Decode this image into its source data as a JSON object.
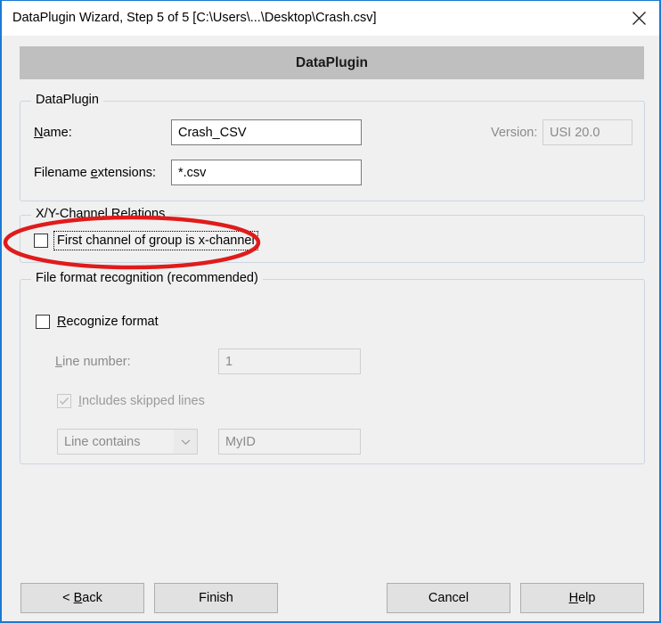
{
  "window": {
    "title": "DataPlugin Wizard, Step 5 of 5 [C:\\Users\\...\\Desktop\\Crash.csv]",
    "close_label": "Close",
    "border_color": "#1a7ad4"
  },
  "banner": {
    "text": "DataPlugin",
    "background": "#bfbfbf"
  },
  "groups": {
    "dataplugin": {
      "title": "DataPlugin",
      "name_label_pre": "",
      "name_label_acc": "N",
      "name_label_post": "ame:",
      "name_value": "Crash_CSV",
      "ext_label_pre": "Filename ",
      "ext_label_acc": "e",
      "ext_label_post": "xtensions:",
      "ext_value": "*.csv",
      "version_label": "Version:",
      "version_value": "USI 20.0"
    },
    "xy_relations": {
      "title": "X/Y-Channel Relations",
      "checkbox_pre": "First channel of ",
      "checkbox_acc": "g",
      "checkbox_post": "roup is x-channel",
      "checkbox_checked": "false"
    },
    "file_format": {
      "title": "File format recognition (recommended)",
      "recognize_pre": "",
      "recognize_acc": "R",
      "recognize_post": "ecognize format",
      "recognize_checked": "false",
      "line_number_pre": "",
      "line_number_acc": "L",
      "line_number_post": "ine number:",
      "line_number_value": "1",
      "includes_pre": "",
      "includes_acc": "I",
      "includes_post": "ncludes skipped lines",
      "includes_checked": "true",
      "condition_selected": "Line contains",
      "condition_value": "MyID"
    }
  },
  "buttons": {
    "back_pre": "< ",
    "back_acc": "B",
    "back_post": "ack",
    "finish": "Finish",
    "cancel": "Cancel",
    "help_pre": "",
    "help_acc": "H",
    "help_post": "elp"
  },
  "annotation": {
    "shape": "red-ellipse",
    "color": "#e01b1b",
    "target": "First channel of group is x-channel"
  }
}
